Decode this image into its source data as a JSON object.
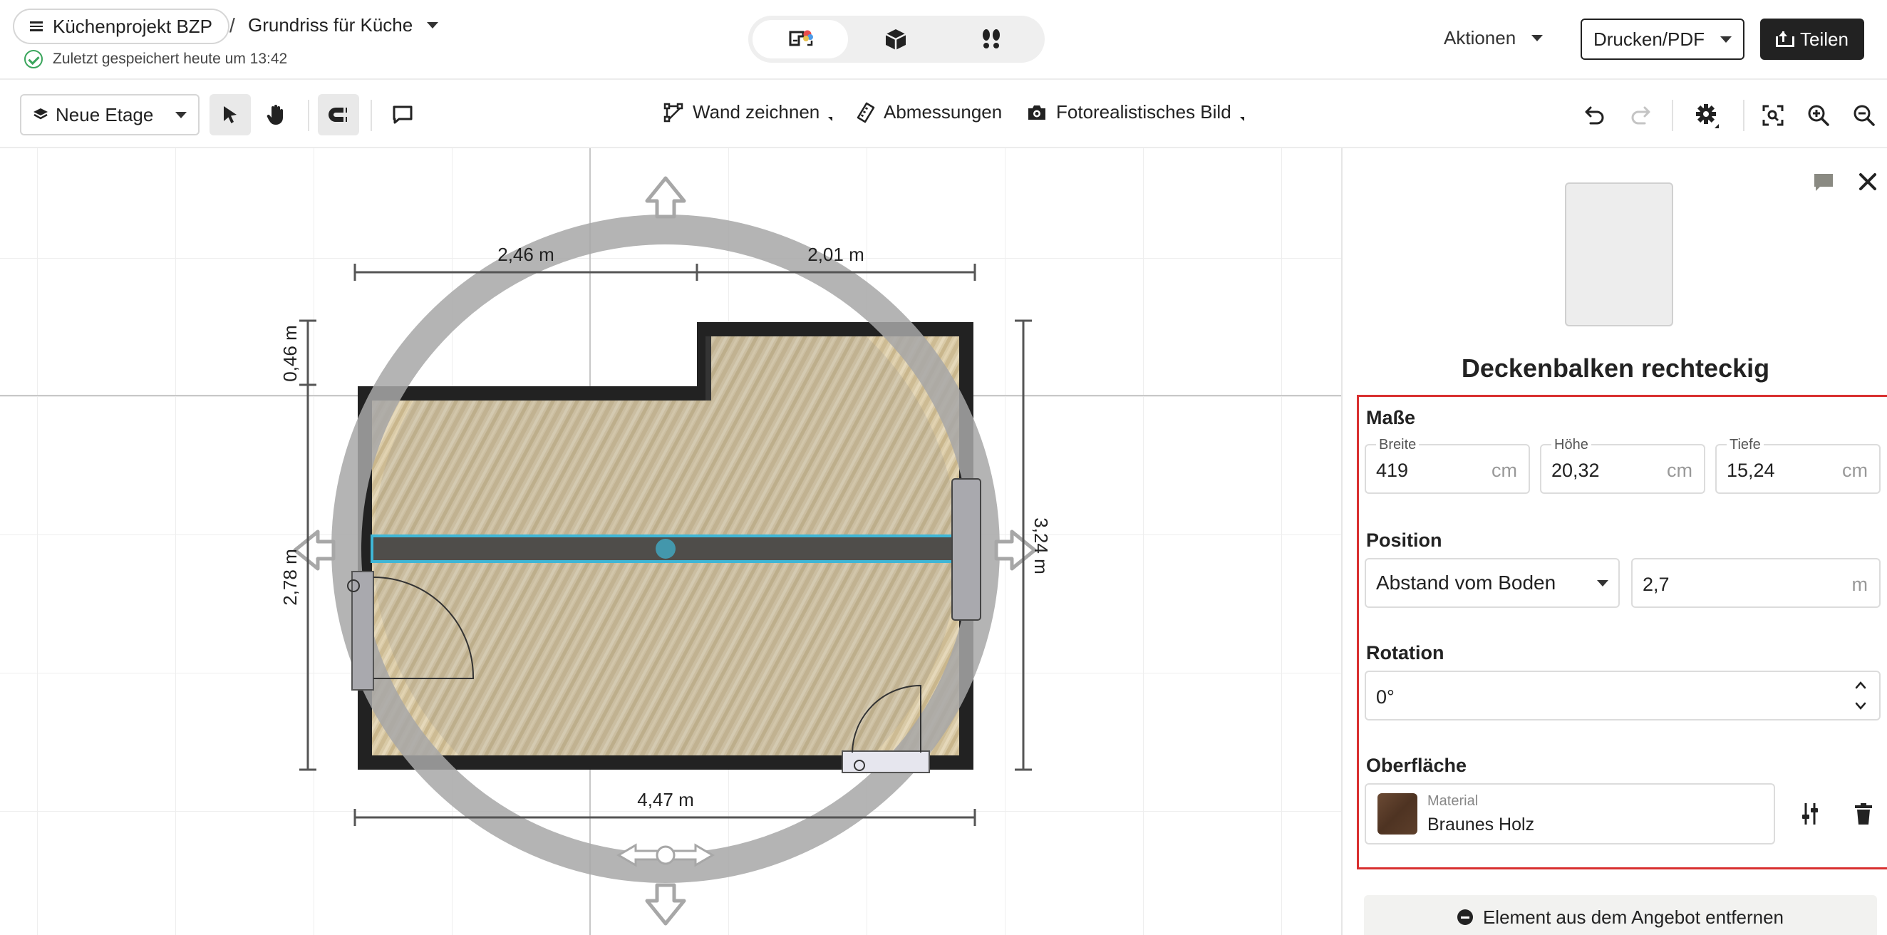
{
  "header": {
    "project": "Küchenprojekt BZP",
    "separator": "/",
    "plan": "Grundriss für Küche",
    "saved": "Zuletzt gespeichert heute um 13:42",
    "view_modes": [
      {
        "icon": "2d-plan-icon",
        "active": true
      },
      {
        "icon": "3d-box-icon",
        "active": false
      },
      {
        "icon": "walkthrough-icon",
        "active": false
      }
    ],
    "actions_label": "Aktionen",
    "print_label": "Drucken/PDF",
    "share_label": "Teilen"
  },
  "toolbar": {
    "floor_label": "Neue Etage",
    "draw_wall": "Wand zeichnen",
    "dimensions": "Abmessungen",
    "photo": "Fotorealistisches Bild"
  },
  "floorplan": {
    "dim_top_left": "2,46 m",
    "dim_top_right": "2,01 m",
    "dim_bottom": "4,47 m",
    "dim_left_top": "0,46 m",
    "dim_left_main": "2,78 m",
    "dim_right": "3,24 m",
    "colors": {
      "wall": "#222222",
      "beam": "#4f4d4a",
      "selection": "#3fb6d6",
      "rotation_ring": "#a7a7a7",
      "floor": "#d8c9a6"
    }
  },
  "panel": {
    "title": "Deckenbalken rechteckig",
    "dimensions_section": "Maße",
    "width_label": "Breite",
    "width_value": "419",
    "height_label": "Höhe",
    "height_value": "20,32",
    "depth_label": "Tiefe",
    "depth_value": "15,24",
    "unit_cm": "cm",
    "position_section": "Position",
    "position_mode": "Abstand vom Boden",
    "position_value": "2,7",
    "unit_m": "m",
    "rotation_section": "Rotation",
    "rotation_value": "0°",
    "surface_section": "Oberfläche",
    "material_label": "Material",
    "material_value": "Braunes Holz",
    "remove_label": "Element aus dem Angebot entfernen",
    "colors": {
      "highlight_border": "#d93030"
    }
  }
}
